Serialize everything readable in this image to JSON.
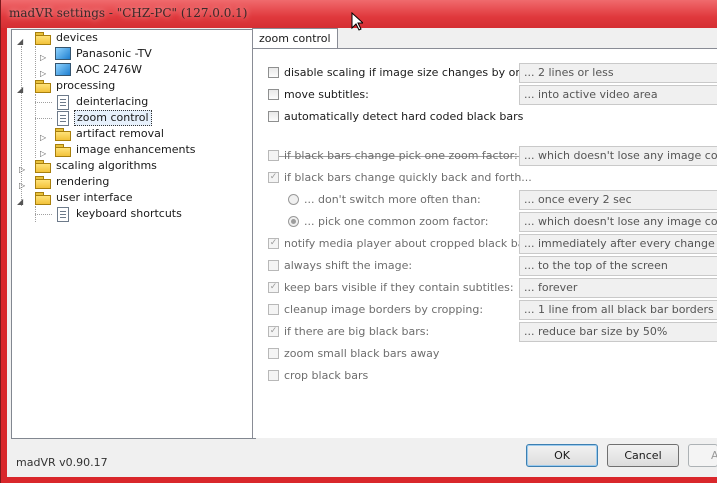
{
  "window": {
    "title": "madVR settings - \"CHZ-PC\" (127.0.0.1)"
  },
  "tree": [
    {
      "label": "devices",
      "icon": "folder-icon"
    },
    {
      "label": "Panasonic -TV",
      "icon": "monitor-icon"
    },
    {
      "label": "AOC 2476W",
      "icon": "monitor-icon"
    },
    {
      "label": "processing",
      "icon": "folder-icon"
    },
    {
      "label": "deinterlacing",
      "icon": "page-icon"
    },
    {
      "label": "zoom control",
      "icon": "page-icon",
      "selected": true
    },
    {
      "label": "artifact removal",
      "icon": "folder-icon"
    },
    {
      "label": "image enhancements",
      "icon": "folder-icon"
    },
    {
      "label": "scaling algorithms",
      "icon": "folder-icon"
    },
    {
      "label": "rendering",
      "icon": "folder-icon"
    },
    {
      "label": "user interface",
      "icon": "folder-icon"
    },
    {
      "label": "keyboard shortcuts",
      "icon": "page-icon"
    }
  ],
  "tab": {
    "label": "zoom control"
  },
  "options": [
    {
      "label": "disable scaling if image size changes by only:",
      "checked": false,
      "enabled": true,
      "combo": "... 2 lines or less"
    },
    {
      "label": "move subtitles:",
      "checked": false,
      "enabled": true,
      "combo": "... into active video area"
    },
    {
      "label": "automatically detect hard coded black bars",
      "checked": false,
      "enabled": true,
      "combo": ""
    },
    {
      "label": "if black bars change pick one zoom factor:",
      "checked": false,
      "enabled": false,
      "combo": "... which doesn't lose any image content"
    },
    {
      "label": "if black bars change quickly back and forth...",
      "checked": true,
      "enabled": false,
      "combo": ""
    },
    {
      "label": "... don't switch more often than:",
      "radio": true,
      "checked": false,
      "enabled": false,
      "combo": "... once every 2 sec"
    },
    {
      "label": "... pick one common zoom factor:",
      "radio": true,
      "checked": true,
      "enabled": false,
      "combo": "... which doesn't lose any image content"
    },
    {
      "label": "notify media player about cropped black bars:",
      "checked": true,
      "enabled": false,
      "combo": "... immediately after every change"
    },
    {
      "label": "always shift the image:",
      "checked": false,
      "enabled": false,
      "combo": "... to the top of the screen"
    },
    {
      "label": "keep bars visible if they contain subtitles:",
      "checked": true,
      "enabled": false,
      "combo": "... forever"
    },
    {
      "label": "cleanup image borders by cropping:",
      "checked": false,
      "enabled": false,
      "combo": "... 1 line from all black bar borders"
    },
    {
      "label": "if there are big black bars:",
      "checked": true,
      "enabled": false,
      "combo": "... reduce bar size by 50%"
    },
    {
      "label": "zoom small black bars away",
      "checked": false,
      "enabled": false,
      "combo": ""
    },
    {
      "label": "crop black bars",
      "checked": false,
      "enabled": false,
      "combo": ""
    }
  ],
  "footer": {
    "version": "madVR v0.90.17",
    "ok_label": "OK",
    "cancel_label": "Cancel",
    "apply_label": "A"
  }
}
